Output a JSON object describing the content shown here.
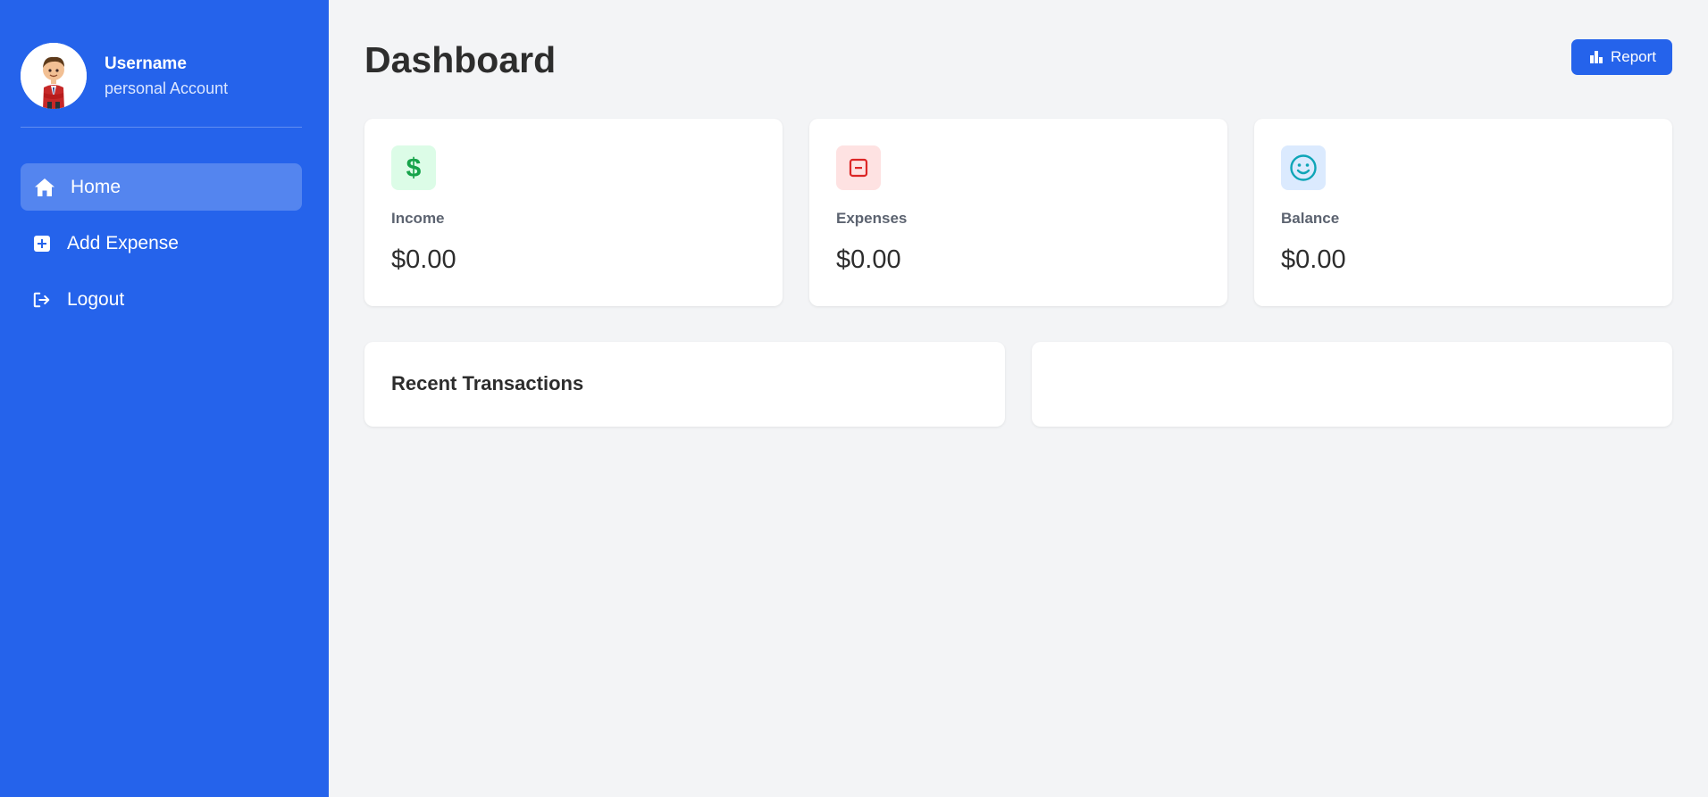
{
  "profile": {
    "username": "Username",
    "account_type": "personal Account"
  },
  "nav": {
    "items": [
      {
        "label": "Home",
        "icon": "home-icon",
        "active": true
      },
      {
        "label": "Add Expense",
        "icon": "plus-square-icon"
      },
      {
        "label": "Logout",
        "icon": "logout-icon"
      }
    ]
  },
  "header": {
    "title": "Dashboard",
    "report_label": "Report",
    "report_icon": "bar-chart-icon"
  },
  "cards": [
    {
      "label": "Income",
      "value": "$0.00",
      "icon": "dollar-icon",
      "color": "#16a34a",
      "bg": "#dcfce7"
    },
    {
      "label": "Expenses",
      "value": "$0.00",
      "icon": "minus-square-icon",
      "color": "#dc2626",
      "bg": "#fee2e2"
    },
    {
      "label": "Balance",
      "value": "$0.00",
      "icon": "smile-icon",
      "color": "#0ea5b7",
      "bg": "#dbeafe"
    }
  ],
  "panels": {
    "recent_title": "Recent Transactions",
    "right_title": ""
  },
  "colors": {
    "primary": "#2563eb",
    "background": "#f3f4f6"
  }
}
